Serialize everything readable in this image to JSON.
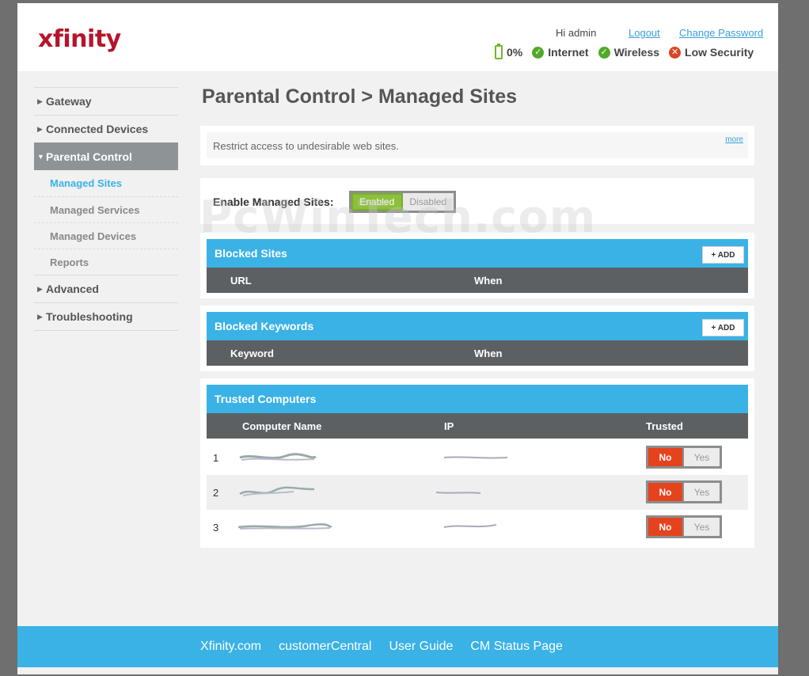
{
  "header": {
    "logo": "xfinity",
    "greeting": "Hi admin",
    "logout": "Logout",
    "change_password": "Change Password",
    "status": {
      "battery": "0%",
      "internet": "Internet",
      "wireless": "Wireless",
      "security": "Low Security"
    }
  },
  "sidebar": {
    "gateway": "Gateway",
    "connected_devices": "Connected Devices",
    "parental_control": "Parental Control",
    "sub": {
      "managed_sites": "Managed Sites",
      "managed_services": "Managed Services",
      "managed_devices": "Managed Devices",
      "reports": "Reports"
    },
    "advanced": "Advanced",
    "troubleshooting": "Troubleshooting"
  },
  "page": {
    "title": "Parental Control > Managed Sites",
    "description": "Restrict access to undesirable web sites.",
    "more": "more",
    "enable_label": "Enable Managed Sites:",
    "toggle": {
      "enabled": "Enabled",
      "disabled": "Disabled",
      "selected": "Enabled"
    }
  },
  "watermark": "PcWinTech.com",
  "blocked_sites": {
    "title": "Blocked Sites",
    "add": "+ ADD",
    "columns": [
      "URL",
      "When"
    ]
  },
  "blocked_keywords": {
    "title": "Blocked Keywords",
    "add": "+ ADD",
    "columns": [
      "Keyword",
      "When"
    ]
  },
  "trusted_computers": {
    "title": "Trusted Computers",
    "columns": [
      "Computer Name",
      "IP",
      "Trusted"
    ],
    "rows": [
      {
        "num": "1",
        "no": "No",
        "yes": "Yes",
        "trusted": "No"
      },
      {
        "num": "2",
        "no": "No",
        "yes": "Yes",
        "trusted": "No"
      },
      {
        "num": "3",
        "no": "No",
        "yes": "Yes",
        "trusted": "No"
      }
    ]
  },
  "footer": {
    "links": [
      "Xfinity.com",
      "customerCentral",
      "User Guide",
      "CM Status Page"
    ]
  },
  "colors": {
    "brand_red": "#b5152b",
    "accent_blue": "#3ab2e6",
    "ok_green": "#52a829",
    "warn_red": "#dd4426",
    "no_red": "#e5431d"
  }
}
